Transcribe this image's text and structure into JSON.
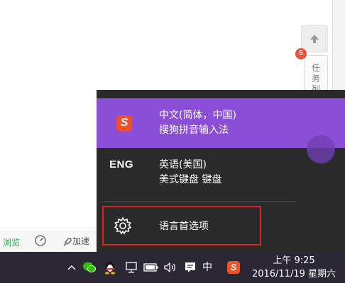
{
  "background": {
    "side_tab_label": [
      "任",
      "务",
      "列"
    ],
    "notification_badge": "5",
    "status_bar": {
      "browse_label": "浏览",
      "accelerate_label": "加速"
    }
  },
  "ime_flyout": {
    "items": [
      {
        "icon": "sogou-s-logo",
        "icon_text": "S",
        "language": "中文(简体，中国)",
        "method": "搜狗拼音输入法",
        "selected": true
      },
      {
        "icon_text": "ENG",
        "language": "英语(美国)",
        "method": "美式键盘 键盘",
        "selected": false
      }
    ],
    "language_preferences_label": "语言首选项"
  },
  "taskbar": {
    "input_indicator": "中",
    "clock_time": "上午 9:25",
    "clock_date": "2016/11/19 星期六"
  },
  "colors": {
    "selected_item": "#8a4fd6",
    "flyout_bg": "#2b2b2b",
    "taskbar_bg": "#2c2735",
    "highlight_border": "#e02222",
    "sogou_orange": "#f0502b"
  }
}
